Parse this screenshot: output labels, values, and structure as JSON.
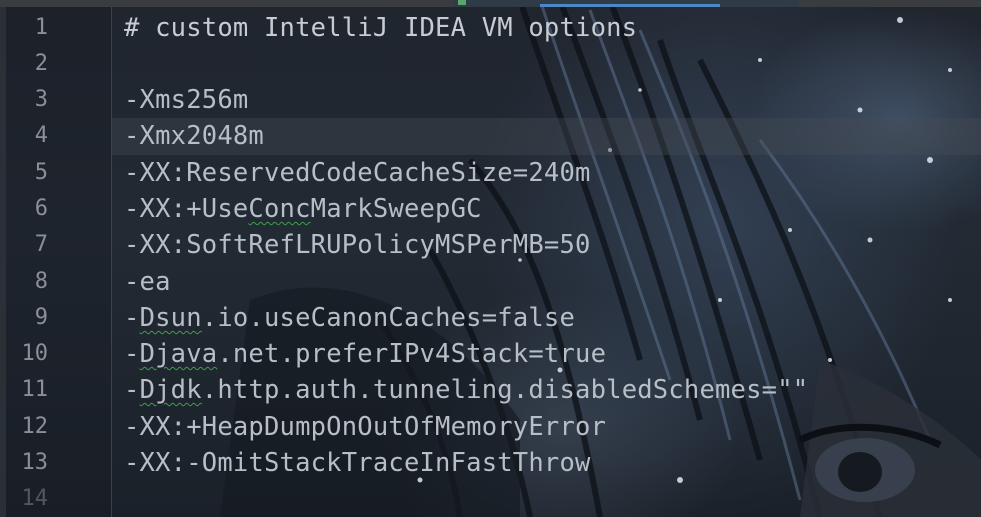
{
  "editor": {
    "lines": [
      {
        "num": "1",
        "text": "# custom IntelliJ IDEA VM options"
      },
      {
        "num": "2",
        "text": ""
      },
      {
        "num": "3",
        "text": "-Xms256m"
      },
      {
        "num": "4",
        "text": "-Xmx2048m"
      },
      {
        "num": "5",
        "text": "-XX:ReservedCodeCacheSize=240m"
      },
      {
        "num": "6",
        "pre": "-XX:+Use",
        "squig": "Conc",
        "post": "MarkSweepGC"
      },
      {
        "num": "7",
        "text": "-XX:SoftRefLRUPolicyMSPerMB=50"
      },
      {
        "num": "8",
        "text": "-ea"
      },
      {
        "num": "9",
        "pre": "-",
        "squig": "Dsun",
        "post": ".io.useCanonCaches=false"
      },
      {
        "num": "10",
        "pre": "-",
        "squig": "Djava",
        "post": ".net.preferIPv4Stack=true"
      },
      {
        "num": "11",
        "pre": "-",
        "squig": "Djdk",
        "post": ".http.auth.tunneling.disabledSchemes=\"\""
      },
      {
        "num": "12",
        "text": "-XX:+HeapDumpOnOutOfMemoryError"
      },
      {
        "num": "13",
        "text": "-XX:-OmitStackTraceInFastThrow"
      },
      {
        "num": "14",
        "text": ""
      }
    ],
    "current_line": "4"
  },
  "colors": {
    "code_text": "#b7bec6",
    "line_number": "#8a9096",
    "spellcheck_squiggle": "#3e9e4a",
    "active_tab_marker": "#59a869"
  }
}
